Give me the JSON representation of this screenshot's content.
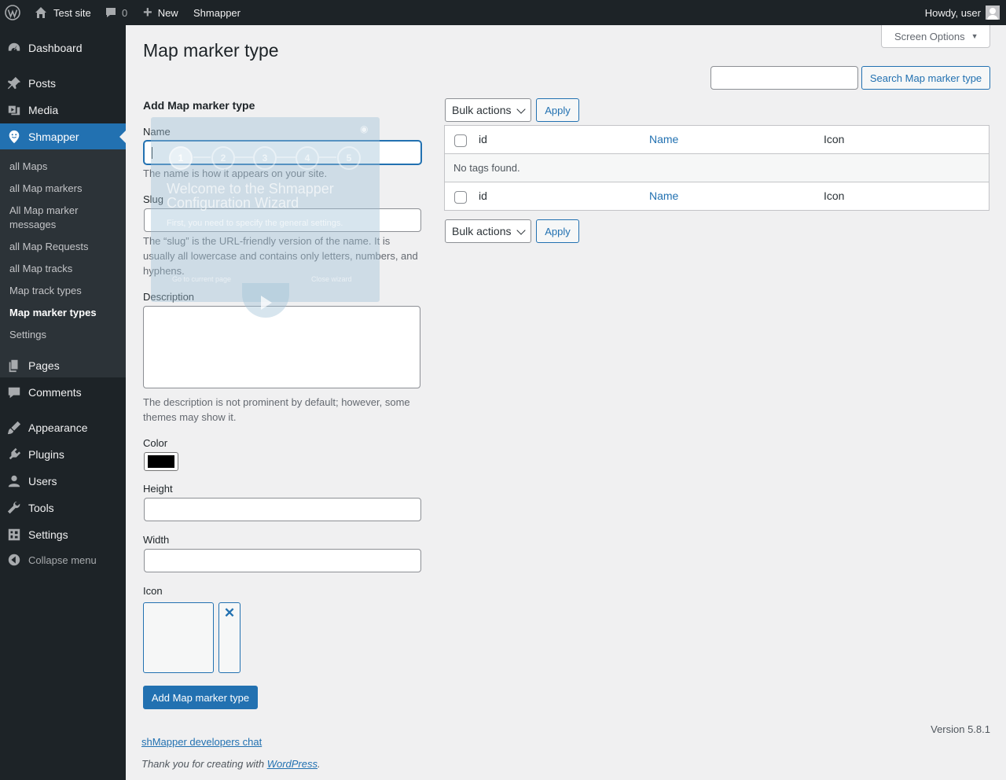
{
  "adminbar": {
    "site_name": "Test site",
    "comments_count": "0",
    "new_label": "New",
    "plugin_label": "Shmapper",
    "howdy": "Howdy, user"
  },
  "sidebar": {
    "items": [
      {
        "label": "Dashboard",
        "icon": "dashboard-icon"
      },
      {
        "label": "Posts",
        "icon": "pin-icon"
      },
      {
        "label": "Media",
        "icon": "media-icon"
      },
      {
        "label": "Shmapper",
        "icon": "shmapper-icon"
      },
      {
        "label": "Pages",
        "icon": "pages-icon"
      },
      {
        "label": "Comments",
        "icon": "comments-icon"
      },
      {
        "label": "Appearance",
        "icon": "appearance-icon"
      },
      {
        "label": "Plugins",
        "icon": "plugins-icon"
      },
      {
        "label": "Users",
        "icon": "users-icon"
      },
      {
        "label": "Tools",
        "icon": "tools-icon"
      },
      {
        "label": "Settings",
        "icon": "settings-icon"
      }
    ],
    "submenu": [
      "all Maps",
      "all Map markers",
      "All Map marker messages",
      "all Map Requests",
      "all Map tracks",
      "Map track types",
      "Map marker types",
      "Settings"
    ],
    "collapse_label": "Collapse menu"
  },
  "header": {
    "screen_options": "Screen Options",
    "title": "Map marker type"
  },
  "search": {
    "value": "",
    "button": "Search Map marker type"
  },
  "form": {
    "title": "Add Map marker type",
    "name_label": "Name",
    "name_help": "The name is how it appears on your site.",
    "slug_label": "Slug",
    "slug_help": "The “slug” is the URL-friendly version of the name. It is usually all lowercase and contains only letters, numbers, and hyphens.",
    "description_label": "Description",
    "description_help": "The description is not prominent by default; however, some themes may show it.",
    "color_label": "Color",
    "color_value": "#000000",
    "height_label": "Height",
    "width_label": "Width",
    "icon_label": "Icon",
    "submit": "Add Map marker type"
  },
  "wizard": {
    "steps": [
      "1",
      "2",
      "3",
      "4",
      "5"
    ],
    "active_step": 1,
    "title": "Welcome to the Shmapper Configuration Wizard",
    "text": "First, you need to specify the general settings.",
    "go_link": "Go to current page",
    "close_link": "Close wizard"
  },
  "table": {
    "bulk_actions": "Bulk actions",
    "apply": "Apply",
    "columns": [
      "id",
      "Name",
      "Icon"
    ],
    "empty": "No tags found."
  },
  "footer": {
    "version": "Version 5.8.1",
    "dev_chat": "shMapper developers chat",
    "thanks_prefix": "Thank you for creating with ",
    "thanks_link": "WordPress",
    "thanks_suffix": "."
  },
  "colors": {
    "accent": "#2271b1",
    "adminbar": "#1d2327",
    "submenu": "#2c3338",
    "background": "#f0f0f1"
  }
}
